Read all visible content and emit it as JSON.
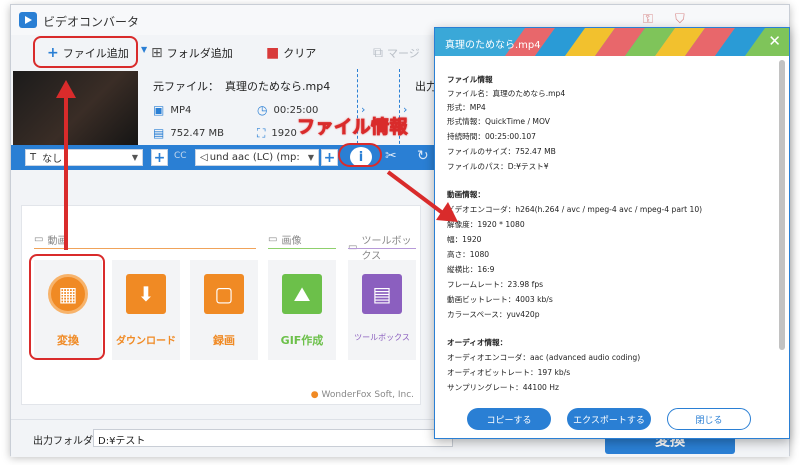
{
  "app": {
    "title": "ビデオコンバータ"
  },
  "toolbar": {
    "add_file": "ファイル追加",
    "add_folder": "フォルダ追加",
    "clear": "クリア",
    "merge": "マージ"
  },
  "file": {
    "source_label": "元ファイル：",
    "source_name": "真理のためなら.mp4",
    "format": "MP4",
    "duration": "00:25:00",
    "size": "752.47 MB",
    "resolution": "1920",
    "output_label": "出力"
  },
  "subbar": {
    "subtitle": "なし",
    "cc_label": "CC",
    "audio": "und aac (LC) (mp:"
  },
  "annotation": {
    "file_info": "ファイル情報"
  },
  "panel": {
    "section_video": "動画",
    "section_image": "画像",
    "section_toolbox": "ツールボックス",
    "tiles": [
      "変換",
      "ダウンロード",
      "録画",
      "GIF作成",
      "ツールボックス"
    ],
    "brand": "WonderFox Soft, Inc."
  },
  "bottom": {
    "output_folder_label": "出力フォルダ：",
    "output_folder_value": "D:¥テスト",
    "convert_button": "変換"
  },
  "dialog": {
    "title": "真理のためなら.mp4",
    "file_info": {
      "heading": "ファイル情報",
      "name": "ファイル名：真理のためなら.mp4",
      "format": "形式：MP4",
      "format_info": "形式情報：QuickTime / MOV",
      "duration": "持続時間：00:25:00.107",
      "size": "ファイルのサイズ：752.47 MB",
      "path": "ファイルのパス：D:¥テスト¥"
    },
    "video_info": {
      "heading": "動画情報：",
      "encoder": "ビデオエンコーダ：h264(h.264 / avc / mpeg-4 avc / mpeg-4 part 10)",
      "resolution": "解像度：1920 * 1080",
      "width": "幅：1920",
      "height": "高さ：1080",
      "aspect": "縦横比：16:9",
      "frame_rate": "フレームレート：23.98 fps",
      "bitrate": "動画ビットレート：4003 kb/s",
      "color_space": "カラースペース：yuv420p"
    },
    "audio_info": {
      "heading": "オーディオ情報：",
      "encoder": "オーディオエンコーダ：aac (advanced audio coding)",
      "bitrate": "オーディオビットレート：197 kb/s",
      "sample_rate": "サンプリングレート：44100 Hz"
    },
    "buttons": {
      "copy": "コピーする",
      "export": "エクスポートする",
      "close": "閉じる"
    }
  },
  "colors": {
    "accent": "#2a7fd4",
    "annotation": "#d92b2b",
    "convert_tile": "#f08a24",
    "gif_tile": "#6cc04a",
    "toolbox_tile": "#8b5fbf"
  }
}
